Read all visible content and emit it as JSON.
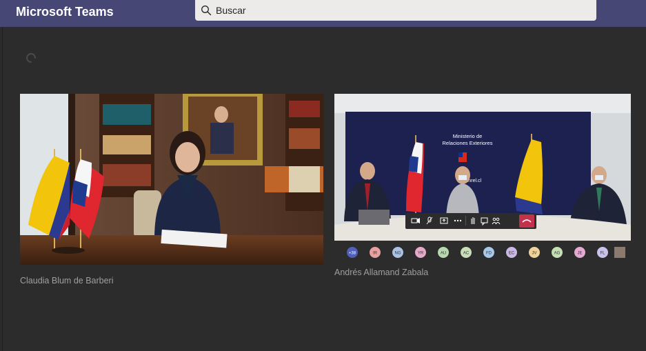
{
  "app": {
    "title": "Microsoft Teams"
  },
  "search": {
    "placeholder": "Buscar"
  },
  "participants": [
    {
      "name": "Claudia Blum de Barberi"
    },
    {
      "name": "Andrés Allamand Zabala"
    }
  ],
  "room_sign": {
    "line1": "Ministerio de",
    "line2": "Relaciones Exteriores",
    "short": "minrel.cl"
  },
  "meeting_toolbar": {
    "items": [
      "camera-icon",
      "mic-icon",
      "share-icon",
      "more-icon",
      "raise-hand-icon",
      "chat-icon",
      "people-icon",
      "hang-up-icon"
    ]
  },
  "avatars": [
    {
      "initials": "+38",
      "color": "#4e5fbf"
    },
    {
      "initials": "IR",
      "color": "#e8a0a0"
    },
    {
      "initials": "NG",
      "color": "#a9c2e6"
    },
    {
      "initials": "YR",
      "color": "#e7a9c9"
    },
    {
      "initials": "AU",
      "color": "#b7d9b0"
    },
    {
      "initials": "AC",
      "color": "#c9dfb7"
    },
    {
      "initials": "FD",
      "color": "#a8c8ea"
    },
    {
      "initials": "EC",
      "color": "#cdb7e6"
    },
    {
      "initials": "JV",
      "color": "#f0d39a"
    },
    {
      "initials": "AG",
      "color": "#c5e0b4"
    },
    {
      "initials": "JE",
      "color": "#e6a9d2"
    },
    {
      "initials": "FL",
      "color": "#c9c2ea"
    }
  ],
  "colors": {
    "titlebar": "#464775",
    "stage": "#2d2c2c",
    "hangup": "#c4314b"
  }
}
